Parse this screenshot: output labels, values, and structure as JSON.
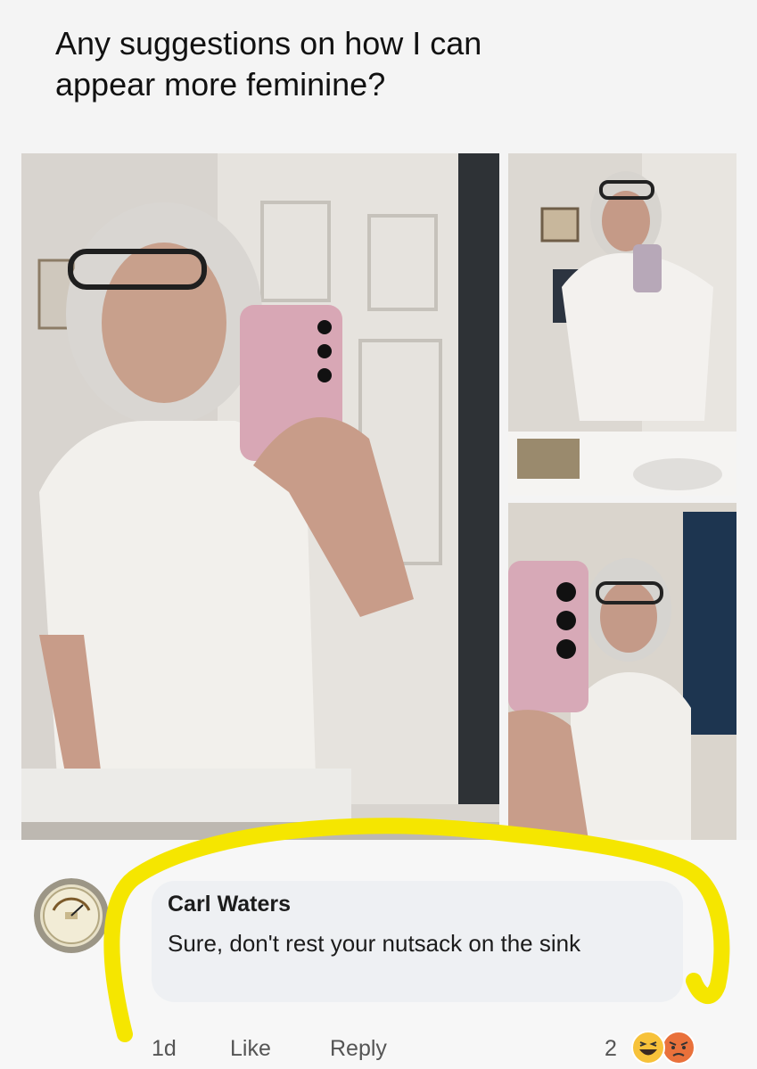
{
  "post": {
    "title": "Any suggestions on how I can\nappear more feminine?"
  },
  "photos": [
    {
      "name": "main-mirror-selfie"
    },
    {
      "name": "mirror-selfie-with-sink"
    },
    {
      "name": "close-up-mirror-selfie"
    }
  ],
  "comment": {
    "author": "Carl Waters",
    "text": "Sure, don't rest your nutsack on the sink",
    "timestamp": "1d",
    "like_label": "Like",
    "reply_label": "Reply",
    "reaction_count": "2",
    "reactions": [
      "haha-icon",
      "angry-icon"
    ],
    "highlight_color": "#f5e600"
  }
}
